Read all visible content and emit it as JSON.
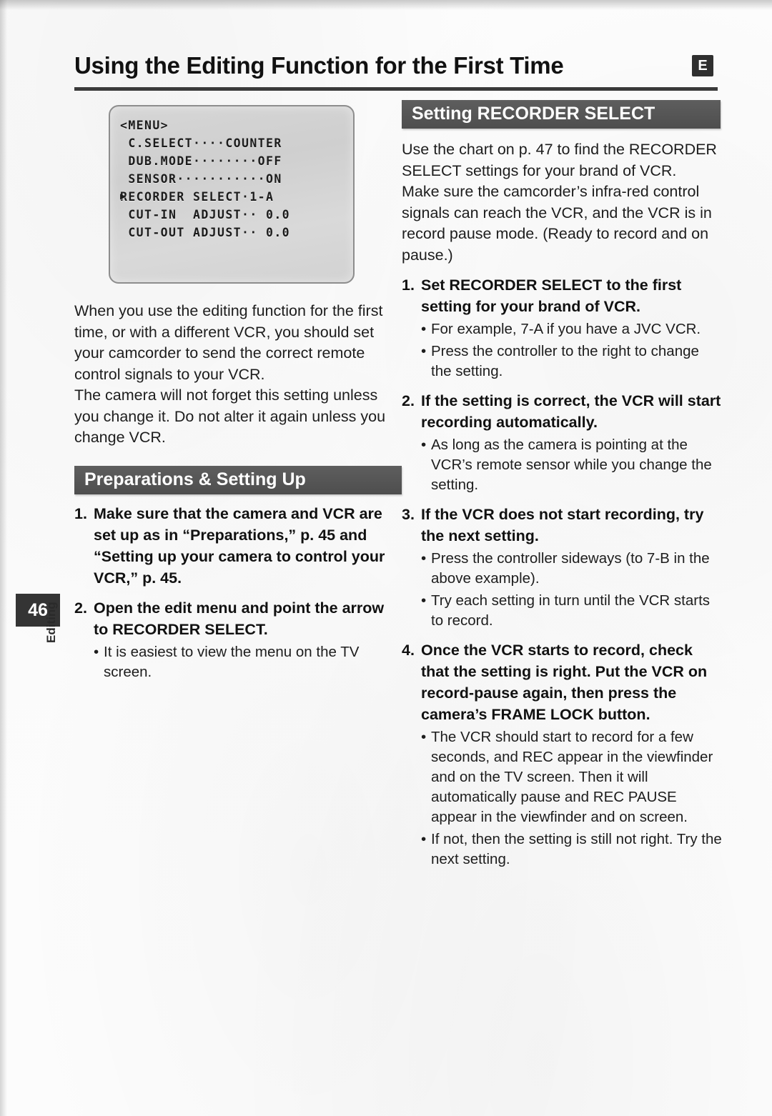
{
  "page": {
    "title": "Using the Editing Function for the First Time",
    "language_badge": "E",
    "page_number": "46",
    "side_tab": "Editing"
  },
  "menu_screen": {
    "caption": "menu-screen-illustration",
    "rows": [
      {
        "cursor": false,
        "text": "<MENU>"
      },
      {
        "cursor": false,
        "text": " C.SELECT····COUNTER"
      },
      {
        "cursor": false,
        "text": " DUB.MODE········OFF"
      },
      {
        "cursor": false,
        "text": " SENSOR···········ON"
      },
      {
        "cursor": true,
        "text": "RECORDER SELECT·1-A"
      },
      {
        "cursor": false,
        "text": " CUT-IN  ADJUST·· 0.0"
      },
      {
        "cursor": false,
        "text": " CUT-OUT ADJUST·· 0.0"
      }
    ]
  },
  "left_column": {
    "intro_paragraph_1": "When you use the editing function for the first time, or with a different VCR, you should set your camcorder to send the correct remote control signals to your VCR.",
    "intro_paragraph_2": "The camera will not forget this setting unless you change it. Do not alter it again unless you change VCR.",
    "banner": "Preparations & Setting Up",
    "steps": [
      {
        "number": "1.",
        "text": "Make sure that the camera and VCR are set up as in “Preparations,” p. 45 and “Setting up your camera to control your VCR,” p. 45.",
        "bullets": []
      },
      {
        "number": "2.",
        "text": "Open the edit menu and point the arrow to RECORDER SELECT.",
        "bullets": [
          "It is easiest to view the menu on the TV screen."
        ]
      }
    ]
  },
  "right_column": {
    "banner": "Setting RECORDER SELECT",
    "intro_paragraph_1": "Use the chart on p. 47 to find the RECORDER SELECT settings for your brand of VCR.",
    "intro_paragraph_2": "Make sure the camcorder’s infra-red control signals can reach the VCR, and the VCR is in record pause mode. (Ready to record and on pause.)",
    "steps": [
      {
        "number": "1.",
        "text": "Set RECORDER SELECT to the first setting for your brand of VCR.",
        "bullets": [
          "For example, 7-A if you have a JVC VCR.",
          "Press the controller to the right to change the setting."
        ]
      },
      {
        "number": "2.",
        "text": "If the setting is correct, the VCR will start recording automatically.",
        "bullets": [
          "As long as the camera is pointing at the VCR’s remote sensor while you change the setting."
        ]
      },
      {
        "number": "3.",
        "text": "If the VCR does not start recording, try the next setting.",
        "bullets": [
          "Press the controller sideways (to 7-B in the above example).",
          "Try each setting in turn until the VCR starts to record."
        ]
      },
      {
        "number": "4.",
        "text": "Once the VCR starts to record, check that the setting is right. Put the VCR on record-pause again, then press the camera’s FRAME LOCK button.",
        "bullets": [
          "The VCR should start to record for a few seconds, and REC appear in the viewfinder and on the TV screen. Then it will automatically pause and REC PAUSE appear in the viewfinder and on screen.",
          "If not, then the setting is still not right. Try the next setting."
        ]
      }
    ]
  },
  "glyphs": {
    "bullet": "•",
    "cursor_arrow": "▶"
  },
  "colors": {
    "banner_bg": "#565656",
    "rule": "#3a3a3a",
    "tab_bg": "#343434",
    "text": "#1d1d1d",
    "screen_bg": "#d4d4d4"
  }
}
